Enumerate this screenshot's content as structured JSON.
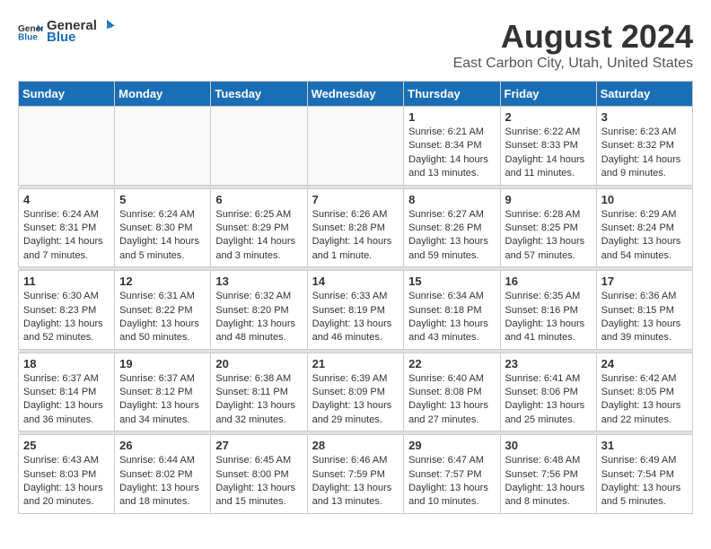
{
  "logo": {
    "general": "General",
    "blue": "Blue"
  },
  "header": {
    "title": "August 2024",
    "subtitle": "East Carbon City, Utah, United States"
  },
  "weekdays": [
    "Sunday",
    "Monday",
    "Tuesday",
    "Wednesday",
    "Thursday",
    "Friday",
    "Saturday"
  ],
  "weeks": [
    [
      {
        "day": "",
        "info": ""
      },
      {
        "day": "",
        "info": ""
      },
      {
        "day": "",
        "info": ""
      },
      {
        "day": "",
        "info": ""
      },
      {
        "day": "1",
        "info": "Sunrise: 6:21 AM\nSunset: 8:34 PM\nDaylight: 14 hours and 13 minutes."
      },
      {
        "day": "2",
        "info": "Sunrise: 6:22 AM\nSunset: 8:33 PM\nDaylight: 14 hours and 11 minutes."
      },
      {
        "day": "3",
        "info": "Sunrise: 6:23 AM\nSunset: 8:32 PM\nDaylight: 14 hours and 9 minutes."
      }
    ],
    [
      {
        "day": "4",
        "info": "Sunrise: 6:24 AM\nSunset: 8:31 PM\nDaylight: 14 hours and 7 minutes."
      },
      {
        "day": "5",
        "info": "Sunrise: 6:24 AM\nSunset: 8:30 PM\nDaylight: 14 hours and 5 minutes."
      },
      {
        "day": "6",
        "info": "Sunrise: 6:25 AM\nSunset: 8:29 PM\nDaylight: 14 hours and 3 minutes."
      },
      {
        "day": "7",
        "info": "Sunrise: 6:26 AM\nSunset: 8:28 PM\nDaylight: 14 hours and 1 minute."
      },
      {
        "day": "8",
        "info": "Sunrise: 6:27 AM\nSunset: 8:26 PM\nDaylight: 13 hours and 59 minutes."
      },
      {
        "day": "9",
        "info": "Sunrise: 6:28 AM\nSunset: 8:25 PM\nDaylight: 13 hours and 57 minutes."
      },
      {
        "day": "10",
        "info": "Sunrise: 6:29 AM\nSunset: 8:24 PM\nDaylight: 13 hours and 54 minutes."
      }
    ],
    [
      {
        "day": "11",
        "info": "Sunrise: 6:30 AM\nSunset: 8:23 PM\nDaylight: 13 hours and 52 minutes."
      },
      {
        "day": "12",
        "info": "Sunrise: 6:31 AM\nSunset: 8:22 PM\nDaylight: 13 hours and 50 minutes."
      },
      {
        "day": "13",
        "info": "Sunrise: 6:32 AM\nSunset: 8:20 PM\nDaylight: 13 hours and 48 minutes."
      },
      {
        "day": "14",
        "info": "Sunrise: 6:33 AM\nSunset: 8:19 PM\nDaylight: 13 hours and 46 minutes."
      },
      {
        "day": "15",
        "info": "Sunrise: 6:34 AM\nSunset: 8:18 PM\nDaylight: 13 hours and 43 minutes."
      },
      {
        "day": "16",
        "info": "Sunrise: 6:35 AM\nSunset: 8:16 PM\nDaylight: 13 hours and 41 minutes."
      },
      {
        "day": "17",
        "info": "Sunrise: 6:36 AM\nSunset: 8:15 PM\nDaylight: 13 hours and 39 minutes."
      }
    ],
    [
      {
        "day": "18",
        "info": "Sunrise: 6:37 AM\nSunset: 8:14 PM\nDaylight: 13 hours and 36 minutes."
      },
      {
        "day": "19",
        "info": "Sunrise: 6:37 AM\nSunset: 8:12 PM\nDaylight: 13 hours and 34 minutes."
      },
      {
        "day": "20",
        "info": "Sunrise: 6:38 AM\nSunset: 8:11 PM\nDaylight: 13 hours and 32 minutes."
      },
      {
        "day": "21",
        "info": "Sunrise: 6:39 AM\nSunset: 8:09 PM\nDaylight: 13 hours and 29 minutes."
      },
      {
        "day": "22",
        "info": "Sunrise: 6:40 AM\nSunset: 8:08 PM\nDaylight: 13 hours and 27 minutes."
      },
      {
        "day": "23",
        "info": "Sunrise: 6:41 AM\nSunset: 8:06 PM\nDaylight: 13 hours and 25 minutes."
      },
      {
        "day": "24",
        "info": "Sunrise: 6:42 AM\nSunset: 8:05 PM\nDaylight: 13 hours and 22 minutes."
      }
    ],
    [
      {
        "day": "25",
        "info": "Sunrise: 6:43 AM\nSunset: 8:03 PM\nDaylight: 13 hours and 20 minutes."
      },
      {
        "day": "26",
        "info": "Sunrise: 6:44 AM\nSunset: 8:02 PM\nDaylight: 13 hours and 18 minutes."
      },
      {
        "day": "27",
        "info": "Sunrise: 6:45 AM\nSunset: 8:00 PM\nDaylight: 13 hours and 15 minutes."
      },
      {
        "day": "28",
        "info": "Sunrise: 6:46 AM\nSunset: 7:59 PM\nDaylight: 13 hours and 13 minutes."
      },
      {
        "day": "29",
        "info": "Sunrise: 6:47 AM\nSunset: 7:57 PM\nDaylight: 13 hours and 10 minutes."
      },
      {
        "day": "30",
        "info": "Sunrise: 6:48 AM\nSunset: 7:56 PM\nDaylight: 13 hours and 8 minutes."
      },
      {
        "day": "31",
        "info": "Sunrise: 6:49 AM\nSunset: 7:54 PM\nDaylight: 13 hours and 5 minutes."
      }
    ]
  ]
}
